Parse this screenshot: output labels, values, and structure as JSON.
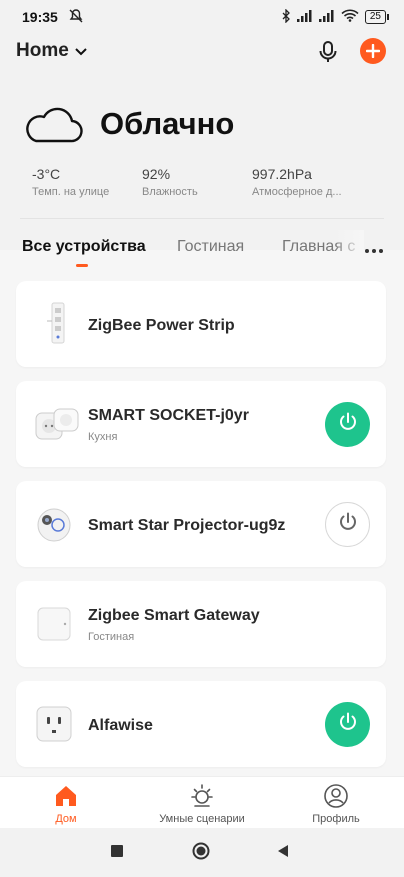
{
  "status_bar": {
    "time": "19:35",
    "battery": "25"
  },
  "header": {
    "home_label": "Home"
  },
  "weather": {
    "condition": "Облачно",
    "stats": [
      {
        "value": "-3°C",
        "label": "Темп. на улице"
      },
      {
        "value": "92%",
        "label": "Влажность"
      },
      {
        "value": "997.2hPa",
        "label": "Атмосферное д..."
      }
    ]
  },
  "tabs": [
    {
      "label": "Все устройства"
    },
    {
      "label": "Гостиная"
    },
    {
      "label": "Главная с"
    }
  ],
  "devices": [
    {
      "name": "ZigBee Power Strip",
      "room": "",
      "power": "none",
      "icon": "power-strip-icon"
    },
    {
      "name": "SMART SOCKET-j0yr",
      "room": "Кухня",
      "power": "on",
      "icon": "smart-socket-icon"
    },
    {
      "name": "Smart Star Projector-ug9z",
      "room": "",
      "power": "off",
      "icon": "projector-icon"
    },
    {
      "name": "Zigbee Smart Gateway",
      "room": "Гостиная",
      "power": "none",
      "icon": "gateway-icon"
    },
    {
      "name": "Alfawise",
      "room": "",
      "power": "on",
      "icon": "wall-outlet-icon"
    }
  ],
  "bottom_nav": [
    {
      "label": "Дом",
      "icon": "home-icon",
      "active": true
    },
    {
      "label": "Умные сценарии",
      "icon": "sun-icon",
      "active": false
    },
    {
      "label": "Профиль",
      "icon": "profile-icon",
      "active": false
    }
  ],
  "colors": {
    "accent": "#ff5a1f",
    "power_on": "#1ec48d"
  }
}
